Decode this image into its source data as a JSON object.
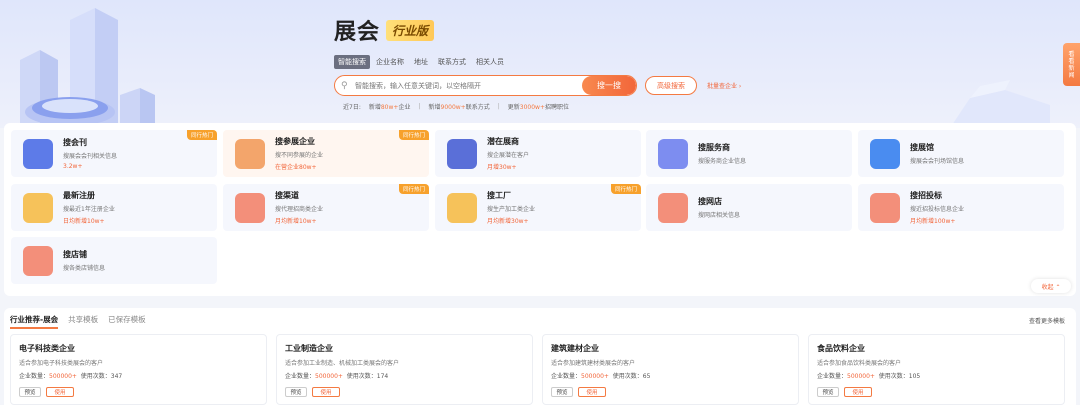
{
  "brand": {
    "title": "展会",
    "badge": "行业版"
  },
  "search_tabs": [
    "智能搜索",
    "企业名称",
    "地址",
    "联系方式",
    "相关人员"
  ],
  "search": {
    "placeholder": "智能搜索，输入任意关键词，以空格隔开",
    "button": "搜一搜",
    "advanced": "高级搜索",
    "batch": "批量查企业 ›"
  },
  "stats": {
    "prefix": "近7日:",
    "s1a": "新增",
    "s1b": "80w+",
    "s1c": "企业",
    "s2a": "新增",
    "s2b": "9000w+",
    "s2c": "联系方式",
    "s3a": "更新",
    "s3b": "3000w+",
    "s3c": "招聘职位"
  },
  "side_tab": [
    "看",
    "看",
    "新",
    "闻"
  ],
  "features": [
    {
      "title": "搜会刊",
      "desc": "搜展会会刊相关信息",
      "sub": "3.2w+",
      "tag": "同行热门",
      "color": "#5d7be8"
    },
    {
      "title": "搜参展企业",
      "desc": "搜不同参展的企业",
      "sub": "在营企业80w+",
      "tag": "同行热门",
      "color": "#f3a56b",
      "warm": true
    },
    {
      "title": "潜在展商",
      "desc": "搜企展潜在客户",
      "sub": "月增30w+",
      "tag": "",
      "color": "#5a6fd8"
    },
    {
      "title": "搜服务商",
      "desc": "搜服务商企业信息",
      "sub": "",
      "tag": "",
      "color": "#7d8df0"
    },
    {
      "title": "搜展馆",
      "desc": "搜展会会刊场馆信息",
      "sub": "",
      "tag": "",
      "color": "#4a8cf0"
    },
    {
      "title": "最新注册",
      "desc": "搜最近1年注册企业",
      "sub": "日均新增10w+",
      "tag": "",
      "color": "#f6c25a"
    },
    {
      "title": "搜渠道",
      "desc": "搜代理招商类企业",
      "sub": "月均新增10w+",
      "tag": "同行热门",
      "color": "#f38f7a"
    },
    {
      "title": "搜工厂",
      "desc": "搜生产加工类企业",
      "sub": "月均新增30w+",
      "tag": "同行热门",
      "color": "#f6c25a"
    },
    {
      "title": "搜网店",
      "desc": "搜网店相关信息",
      "sub": "",
      "tag": "",
      "color": "#f38f7a"
    },
    {
      "title": "搜招投标",
      "desc": "搜近招投标信息企业",
      "sub": "月均新增100w+",
      "tag": "",
      "color": "#f38f7a"
    },
    {
      "title": "搜店铺",
      "desc": "搜各类店铺信息",
      "sub": "",
      "tag": "",
      "color": "#f38f7a"
    }
  ],
  "collapse": "收起 ⌃",
  "template_tabs": [
    "行业推荐-展会",
    "共享模板",
    "已保存模板"
  ],
  "template_more": "查看更多模板",
  "templates": [
    {
      "title": "电子科技类企业",
      "desc": "适合参加电子科技类展会的客户",
      "count_label": "企业数量：",
      "count": "500000+",
      "use_label": "使用次数：",
      "uses": "347",
      "preview": "预览",
      "use": "使用"
    },
    {
      "title": "工业制造企业",
      "desc": "适合参加工业制造、机械加工类展会的客户",
      "count_label": "企业数量：",
      "count": "500000+",
      "use_label": "使用次数：",
      "uses": "174",
      "preview": "预览",
      "use": "使用"
    },
    {
      "title": "建筑建材企业",
      "desc": "适合参加建筑建材类展会的客户",
      "count_label": "企业数量：",
      "count": "500000+",
      "use_label": "使用次数：",
      "uses": "65",
      "preview": "预览",
      "use": "使用"
    },
    {
      "title": "食品饮料企业",
      "desc": "适合参加食品饮料类展会的客户",
      "count_label": "企业数量：",
      "count": "500000+",
      "use_label": "使用次数：",
      "uses": "105",
      "preview": "预览",
      "use": "使用"
    }
  ]
}
